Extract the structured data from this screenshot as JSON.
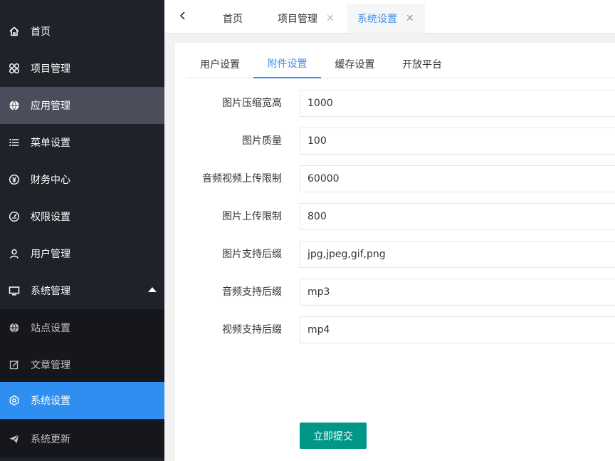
{
  "sidebar": {
    "items": [
      {
        "label": "首页",
        "icon": "home-icon"
      },
      {
        "label": "项目管理",
        "icon": "grid-icon"
      },
      {
        "label": "应用管理",
        "icon": "globe-icon"
      },
      {
        "label": "菜单设置",
        "icon": "list-icon"
      },
      {
        "label": "财务中心",
        "icon": "yen-icon"
      },
      {
        "label": "权限设置",
        "icon": "gauge-icon"
      },
      {
        "label": "用户管理",
        "icon": "user-icon"
      },
      {
        "label": "系统管理",
        "icon": "monitor-icon"
      }
    ],
    "sub_items": [
      {
        "label": "站点设置",
        "icon": "globe-icon"
      },
      {
        "label": "文章管理",
        "icon": "edit-icon"
      },
      {
        "label": "系统设置",
        "icon": "settings-icon"
      },
      {
        "label": "系统更新",
        "icon": "send-icon"
      }
    ]
  },
  "tabs": [
    {
      "label": "首页"
    },
    {
      "label": "项目管理",
      "close": "✕"
    },
    {
      "label": "系统设置",
      "close": "✕"
    }
  ],
  "subtabs": [
    "用户设置",
    "附件设置",
    "缓存设置",
    "开放平台"
  ],
  "form": {
    "fields": [
      {
        "label": "图片压缩宽高",
        "value": "1000"
      },
      {
        "label": "图片质量",
        "value": "100"
      },
      {
        "label": "音频视频上传限制",
        "value": "60000"
      },
      {
        "label": "图片上传限制",
        "value": "800"
      },
      {
        "label": "图片支持后缀",
        "value": "jpg,jpeg,gif,png"
      },
      {
        "label": "音频支持后缀",
        "value": "mp3"
      },
      {
        "label": "视频支持后缀",
        "value": "mp4"
      }
    ],
    "submit_label": "立即提交"
  },
  "colors": {
    "sidebar_bg": "#20222a",
    "active_parent": "#4a4e5a",
    "selected": "#2f8ff0",
    "accent": "#3b8ee6",
    "submit": "#009688"
  }
}
